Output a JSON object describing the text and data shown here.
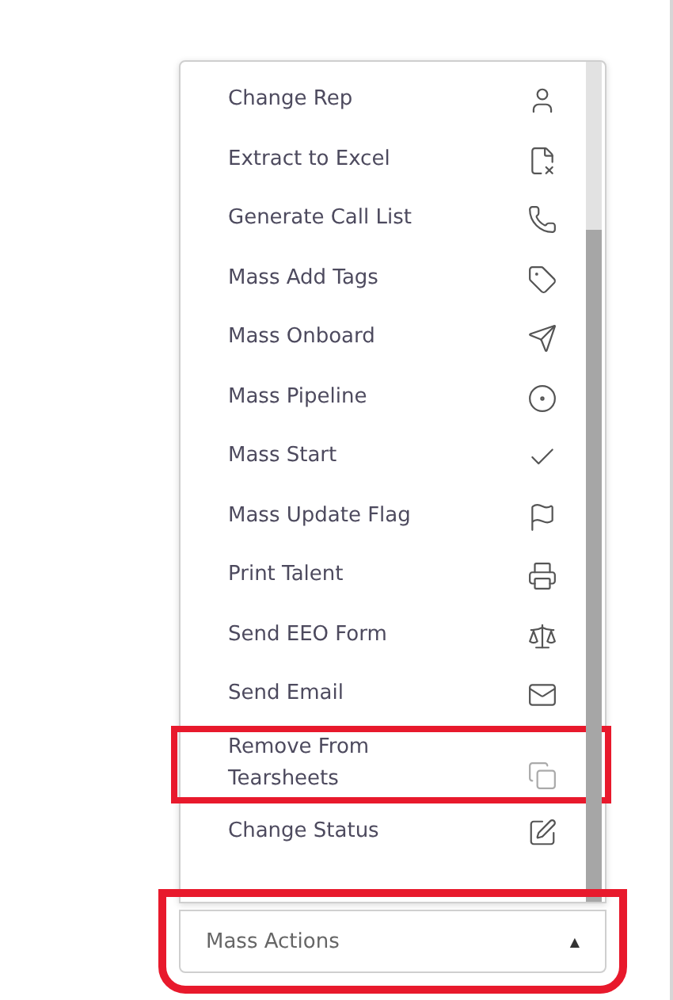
{
  "menu": {
    "items": [
      {
        "label": "Change Rep",
        "highlighted": false
      },
      {
        "label": "Extract to Excel",
        "highlighted": false
      },
      {
        "label": "Generate Call List",
        "highlighted": false
      },
      {
        "label": "Mass Add Tags",
        "highlighted": false
      },
      {
        "label": "Mass Onboard",
        "highlighted": false
      },
      {
        "label": "Mass Pipeline",
        "highlighted": false
      },
      {
        "label": "Mass Start",
        "highlighted": false
      },
      {
        "label": "Mass Update Flag",
        "highlighted": false
      },
      {
        "label": "Print Talent",
        "highlighted": false
      },
      {
        "label": "Send EEO Form",
        "highlighted": false
      },
      {
        "label": "Send Email",
        "highlighted": false
      },
      {
        "label": "Remove From Tearsheets",
        "highlighted": true
      },
      {
        "label": "Change Status",
        "highlighted": false
      }
    ]
  },
  "dropdown": {
    "label": "Mass Actions",
    "caret": "▲",
    "highlighted": true
  }
}
